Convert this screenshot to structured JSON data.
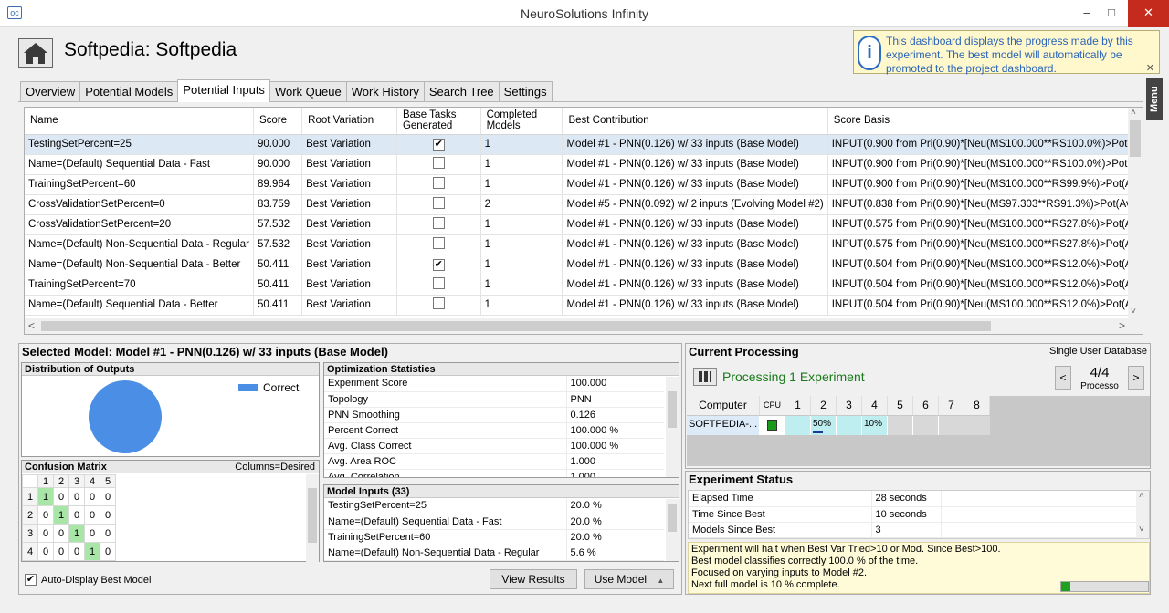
{
  "window": {
    "title": "NeuroSolutions Infinity",
    "app_icon": "oc"
  },
  "header": {
    "title": "Softpedia:  Softpedia"
  },
  "info": {
    "text": "This dashboard displays the progress made by this experiment. The best model will automatically be promoted to the project dashboard.",
    "close": "✕",
    "glyph": "i"
  },
  "menu_tab": "Menu",
  "tabs": [
    "Overview",
    "Potential Models",
    "Potential Inputs",
    "Work Queue",
    "Work History",
    "Search Tree",
    "Settings"
  ],
  "grid": {
    "columns": [
      "Name",
      "Score",
      "Root Variation",
      "Base Tasks Generated",
      "Completed Models",
      "Best Contribution",
      "Score Basis"
    ],
    "rows": [
      {
        "name": "TestingSetPercent=25",
        "score": "90.000",
        "root": "Best Variation",
        "checked": true,
        "completed": "1",
        "best": "Model #1 - PNN(0.126) w/ 33 inputs (Base Model)",
        "basis": "INPUT(0.900 from Pri(0.90)*[Neu(MS100.000**RS100.0%)>Pot(A"
      },
      {
        "name": "Name=(Default) Sequential Data - Fast",
        "score": "90.000",
        "root": "Best Variation",
        "checked": false,
        "completed": "1",
        "best": "Model #1 - PNN(0.126) w/ 33 inputs (Base Model)",
        "basis": "INPUT(0.900 from Pri(0.90)*[Neu(MS100.000**RS100.0%)>Pot(A"
      },
      {
        "name": "TrainingSetPercent=60",
        "score": "89.964",
        "root": "Best Variation",
        "checked": false,
        "completed": "1",
        "best": "Model #1 - PNN(0.126) w/ 33 inputs (Base Model)",
        "basis": "INPUT(0.900 from Pri(0.90)*[Neu(MS100.000**RS99.9%)>Pot(A"
      },
      {
        "name": "CrossValidationSetPercent=0",
        "score": "83.759",
        "root": "Best Variation",
        "checked": false,
        "completed": "2",
        "best": "Model #5 - PNN(0.092) w/ 2 inputs (Evolving Model #2)",
        "basis": "INPUT(0.838 from Pri(0.90)*[Neu(MS97.303**RS91.3%)>Pot(Av"
      },
      {
        "name": "CrossValidationSetPercent=20",
        "score": "57.532",
        "root": "Best Variation",
        "checked": false,
        "completed": "1",
        "best": "Model #1 - PNN(0.126) w/ 33 inputs (Base Model)",
        "basis": "INPUT(0.575 from Pri(0.90)*[Neu(MS100.000**RS27.8%)>Pot(A"
      },
      {
        "name": "Name=(Default) Non-Sequential Data - Regular",
        "score": "57.532",
        "root": "Best Variation",
        "checked": false,
        "completed": "1",
        "best": "Model #1 - PNN(0.126) w/ 33 inputs (Base Model)",
        "basis": "INPUT(0.575 from Pri(0.90)*[Neu(MS100.000**RS27.8%)>Pot(A"
      },
      {
        "name": "Name=(Default) Non-Sequential Data - Better",
        "score": "50.411",
        "root": "Best Variation",
        "checked": true,
        "completed": "1",
        "best": "Model #1 - PNN(0.126) w/ 33 inputs (Base Model)",
        "basis": "INPUT(0.504 from Pri(0.90)*[Neu(MS100.000**RS12.0%)>Pot(A"
      },
      {
        "name": "TrainingSetPercent=70",
        "score": "50.411",
        "root": "Best Variation",
        "checked": false,
        "completed": "1",
        "best": "Model #1 - PNN(0.126) w/ 33 inputs (Base Model)",
        "basis": "INPUT(0.504 from Pri(0.90)*[Neu(MS100.000**RS12.0%)>Pot(A"
      },
      {
        "name": "Name=(Default) Sequential Data - Better",
        "score": "50.411",
        "root": "Best Variation",
        "checked": false,
        "completed": "1",
        "best": "Model #1 - PNN(0.126) w/ 33 inputs (Base Model)",
        "basis": "INPUT(0.504 from Pri(0.90)*[Neu(MS100.000**RS12.0%)>Pot(A"
      }
    ]
  },
  "selected": {
    "title": "Selected Model: Model #1 - PNN(0.126) w/ 33 inputs (Base Model)",
    "dist_title": "Distribution of Outputs",
    "legend": "Correct",
    "pie_color": "#4b8ee6",
    "cm_title": "Confusion Matrix",
    "cm_note": "Columns=Desired",
    "cm_cols": [
      "1",
      "2",
      "3",
      "4",
      "5"
    ],
    "cm_rows": [
      {
        "label": "1",
        "cells": [
          "1",
          "0",
          "0",
          "0",
          "0"
        ]
      },
      {
        "label": "2",
        "cells": [
          "0",
          "1",
          "0",
          "0",
          "0"
        ]
      },
      {
        "label": "3",
        "cells": [
          "0",
          "0",
          "1",
          "0",
          "0"
        ]
      },
      {
        "label": "4",
        "cells": [
          "0",
          "0",
          "0",
          "1",
          "0"
        ]
      }
    ],
    "auto_display": "Auto-Display Best Model",
    "opt_title": "Optimization Statistics",
    "opt": [
      {
        "k": "Experiment Score",
        "v": "100.000"
      },
      {
        "k": "Topology",
        "v": "PNN"
      },
      {
        "k": "PNN Smoothing",
        "v": "0.126"
      },
      {
        "k": "Percent Correct",
        "v": "100.000 %"
      },
      {
        "k": "Avg. Class Correct",
        "v": "100.000 %"
      },
      {
        "k": "Avg. Area ROC",
        "v": "1.000"
      },
      {
        "k": "Avg. Correlation",
        "v": "1.000"
      }
    ],
    "inputs_title": "Model Inputs (33)",
    "inputs": [
      {
        "k": "TestingSetPercent=25",
        "v": "20.0 %"
      },
      {
        "k": "Name=(Default) Sequential Data - Fast",
        "v": "20.0 %"
      },
      {
        "k": "TrainingSetPercent=60",
        "v": "20.0 %"
      },
      {
        "k": "Name=(Default) Non-Sequential Data - Regular",
        "v": "5.6 %"
      }
    ],
    "view_results": "View Results",
    "use_model": "Use Model"
  },
  "processing": {
    "title": "Current Processing",
    "db": "Single User Database",
    "status": "Processing 1 Experiment",
    "count": "4/4",
    "count_label": "Processo",
    "prev": "<",
    "next": ">",
    "cols": [
      "Computer",
      "CPU",
      "1",
      "2",
      "3",
      "4",
      "5",
      "6",
      "7",
      "8"
    ],
    "computer": "SOFTPEDIA-...",
    "p2": "50%",
    "p4": "10%"
  },
  "status": {
    "title": "Experiment Status",
    "rows": [
      {
        "k": "Elapsed Time",
        "v": "28 seconds"
      },
      {
        "k": "Time Since Best",
        "v": "10 seconds"
      },
      {
        "k": "Models Since Best",
        "v": "3"
      }
    ],
    "note": [
      "Experiment will halt when Best Var Tried>10 or Mod. Since Best>100.",
      "Best model classifies correctly 100.0 % of the time.",
      "Focused on varying inputs to Model #2.",
      "Next full model is 10 % complete."
    ],
    "progress": 0.1
  }
}
